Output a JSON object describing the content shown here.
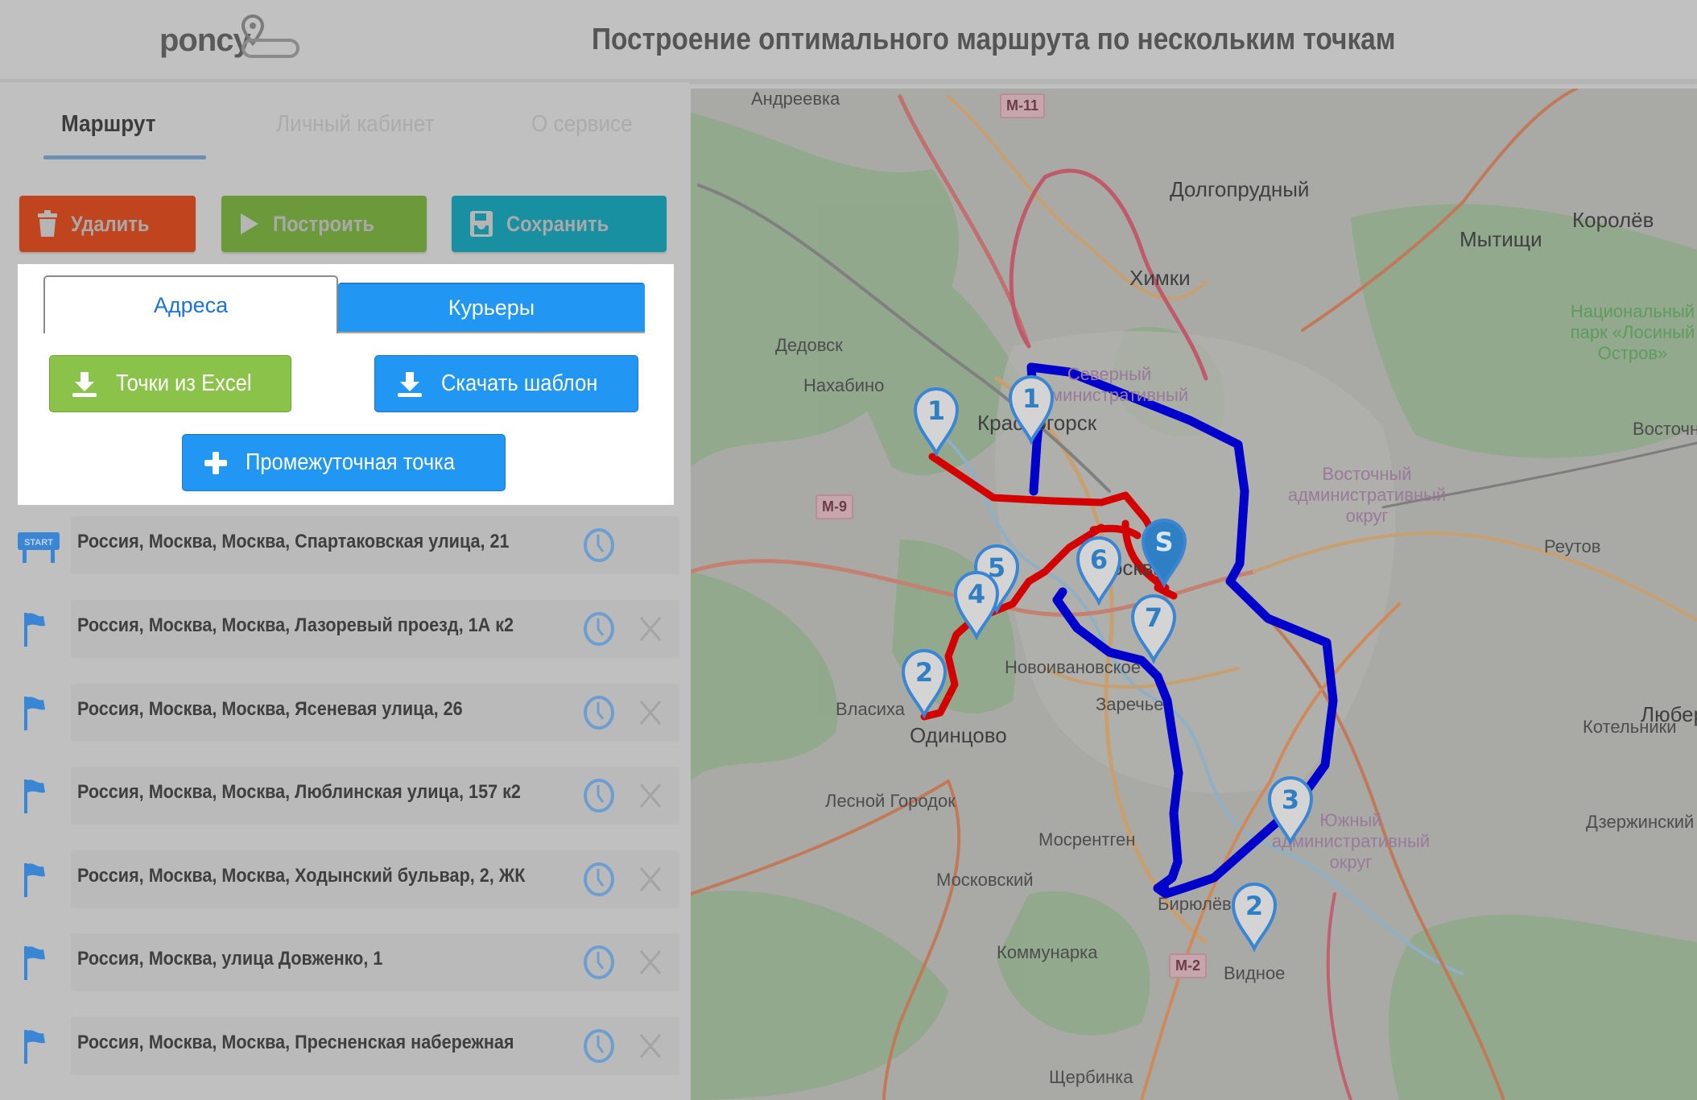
{
  "header": {
    "logo_text": "poncy",
    "title": "Построение оптимального маршрута по нескольким точкам"
  },
  "nav": {
    "tabs": [
      {
        "label": "Маршрут",
        "active": true
      },
      {
        "label": "Личный кабинет",
        "active": false
      },
      {
        "label": "О сервисе",
        "active": false
      }
    ]
  },
  "actions": {
    "delete_label": "Удалить",
    "build_label": "Построить",
    "save_label": "Сохранить"
  },
  "panel": {
    "tabs": [
      {
        "label": "Адреса",
        "active": true
      },
      {
        "label": "Курьеры",
        "active": false
      }
    ],
    "excel_button": "Точки из Excel",
    "template_button": "Скачать шаблон",
    "waypoint_button": "Промежуточная точка"
  },
  "addresses": [
    {
      "type": "start",
      "icon": "start-sign-icon",
      "text": "Россия, Москва, Москва, Спартаковская улица, 21",
      "removable": false
    },
    {
      "type": "point",
      "icon": "flag-icon",
      "text": "Россия, Москва, Москва, Лазоревый проезд, 1А к2",
      "removable": true
    },
    {
      "type": "point",
      "icon": "flag-icon",
      "text": "Россия, Москва, Москва, Ясеневая улица, 26",
      "removable": true
    },
    {
      "type": "point",
      "icon": "flag-icon",
      "text": "Россия, Москва, Москва, Люблинская улица, 157 к2",
      "removable": true
    },
    {
      "type": "point",
      "icon": "flag-icon",
      "text": "Россия, Москва, Москва, Ходынский бульвар, 2, ЖК",
      "removable": true
    },
    {
      "type": "point",
      "icon": "flag-icon",
      "text": "Россия, Москва, улица Довженко, 1",
      "removable": true
    },
    {
      "type": "point",
      "icon": "flag-icon",
      "text": "Россия, Москва, Москва, Пресненская набережная",
      "removable": true
    }
  ],
  "map": {
    "place_labels": [
      {
        "text": "Андреевка",
        "kind": "small"
      },
      {
        "text": "Долгопрудный",
        "kind": "big"
      },
      {
        "text": "Мытищи",
        "kind": "big"
      },
      {
        "text": "Королёв",
        "kind": "big"
      },
      {
        "text": "Химки",
        "kind": "big"
      },
      {
        "text": "Дедовск",
        "kind": "small"
      },
      {
        "text": "Нахабино",
        "kind": "small"
      },
      {
        "text": "Красногорск",
        "kind": "big"
      },
      {
        "text": "Москва",
        "kind": "big"
      },
      {
        "text": "Одинцово",
        "kind": "big"
      },
      {
        "text": "Власиха",
        "kind": "small"
      },
      {
        "text": "Новоивановское",
        "kind": "small"
      },
      {
        "text": "Заречье",
        "kind": "small"
      },
      {
        "text": "Лесной Городок",
        "kind": "small"
      },
      {
        "text": "Мосрентген",
        "kind": "small"
      },
      {
        "text": "Московский",
        "kind": "small"
      },
      {
        "text": "Коммунарка",
        "kind": "small"
      },
      {
        "text": "Щербинка",
        "kind": "small"
      },
      {
        "text": "Видное",
        "kind": "small"
      },
      {
        "text": "Бирюлёво",
        "kind": "small"
      },
      {
        "text": "Реутов",
        "kind": "small"
      },
      {
        "text": "Люберцы",
        "kind": "big"
      },
      {
        "text": "Дзержинский",
        "kind": "small"
      },
      {
        "text": "Котельники",
        "kind": "small"
      },
      {
        "text": "Восточный",
        "kind": "small"
      },
      {
        "text": "Северный административный",
        "kind": "district"
      },
      {
        "text": "Восточный административный округ",
        "kind": "district"
      },
      {
        "text": "Южный административный округ",
        "kind": "district"
      },
      {
        "text": "Национальный парк «Лосиный Остров»",
        "kind": "park"
      }
    ],
    "road_shields": [
      "M-11",
      "M-9",
      "M-2"
    ],
    "start_marker": "S",
    "routes": [
      {
        "name": "red-route",
        "color": "#d40000",
        "markers": [
          "1",
          "2",
          "4",
          "5",
          "6",
          "7"
        ]
      },
      {
        "name": "blue-route",
        "color": "#0000cc",
        "markers": [
          "1",
          "3",
          "2"
        ]
      }
    ]
  },
  "colors": {
    "primary": "#2196f3",
    "success": "#8bc34a",
    "danger": "#c0441d",
    "build": "#6c9a3a",
    "save": "#1990a2",
    "overlay": "#c0c0c0"
  }
}
